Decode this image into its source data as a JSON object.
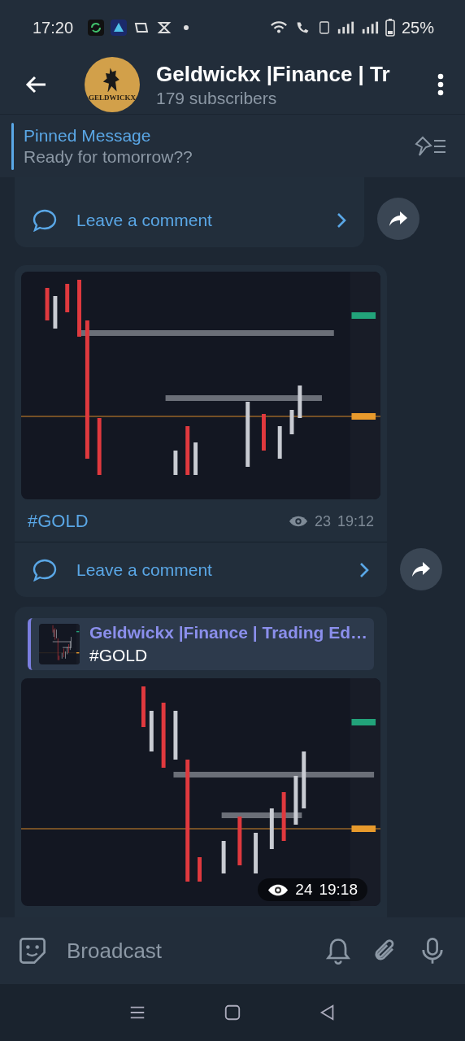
{
  "status_bar": {
    "time": "17:20",
    "battery": "25%"
  },
  "header": {
    "title": "Geldwickx |Finance | Tr",
    "subtitle": "179 subscribers",
    "avatar_label": "GELDWICKX"
  },
  "pinned": {
    "label": "Pinned Message",
    "text": "Ready for tomorrow??"
  },
  "messages": [
    {
      "kind": "comment_only",
      "comment": "Leave a comment"
    },
    {
      "caption": "#GOLD",
      "views": "23",
      "time": "19:12",
      "comment": "Leave a comment"
    },
    {
      "kind": "reply_photo",
      "reply": {
        "author": "Geldwickx |Finance | Trading Ed…",
        "text": "#GOLD"
      },
      "views": "24",
      "time": "19:18"
    }
  ],
  "composer": {
    "placeholder": "Broadcast"
  }
}
